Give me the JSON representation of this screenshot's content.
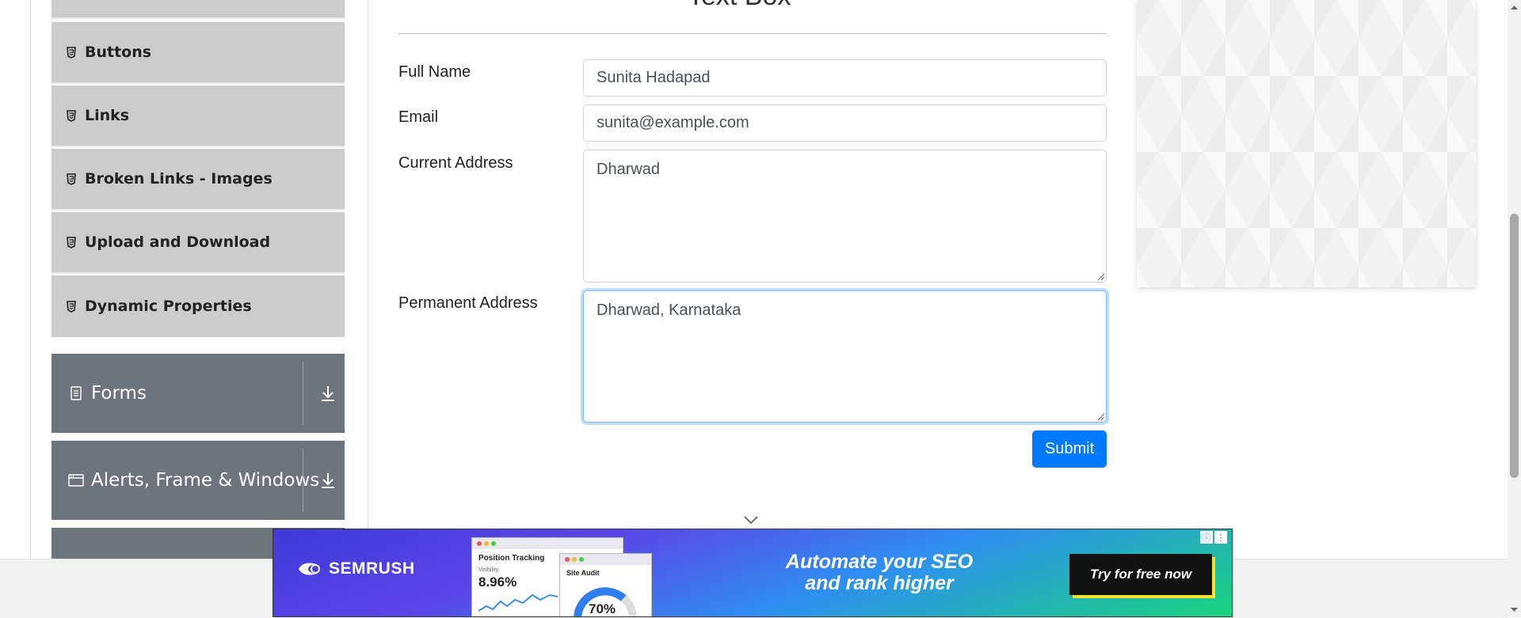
{
  "sidebar": {
    "elements_items": [
      {
        "label": "Buttons"
      },
      {
        "label": "Links"
      },
      {
        "label": "Broken Links - Images"
      },
      {
        "label": "Upload and Download"
      },
      {
        "label": "Dynamic Properties"
      }
    ],
    "groups": [
      {
        "label": "Forms"
      },
      {
        "label": "Alerts, Frame & Windows"
      }
    ]
  },
  "form": {
    "title_fragment": "Text Box",
    "full_name": {
      "label": "Full Name",
      "value": "Sunita Hadapad"
    },
    "email": {
      "label": "Email",
      "value": "sunita@example.com"
    },
    "current_address": {
      "label": "Current Address",
      "value": "Dharwad"
    },
    "permanent_address": {
      "label": "Permanent Address",
      "value": "Dharwad, Karnataka"
    },
    "submit_label": "Submit"
  },
  "ad": {
    "brand": "SEMRUSH",
    "tagline_line1": "Automate your SEO",
    "tagline_line2": "and rank higher",
    "cta": "Try for free now",
    "card1_title": "Position Tracking",
    "card1_sub": "Visibility",
    "card1_value": "8.96%",
    "card2_title": "Site Audit",
    "card2_value": "70%"
  },
  "colors": {
    "accent": "#007bff",
    "sidebar_group": "#6c757d",
    "sidebar_item": "#cccccc"
  }
}
